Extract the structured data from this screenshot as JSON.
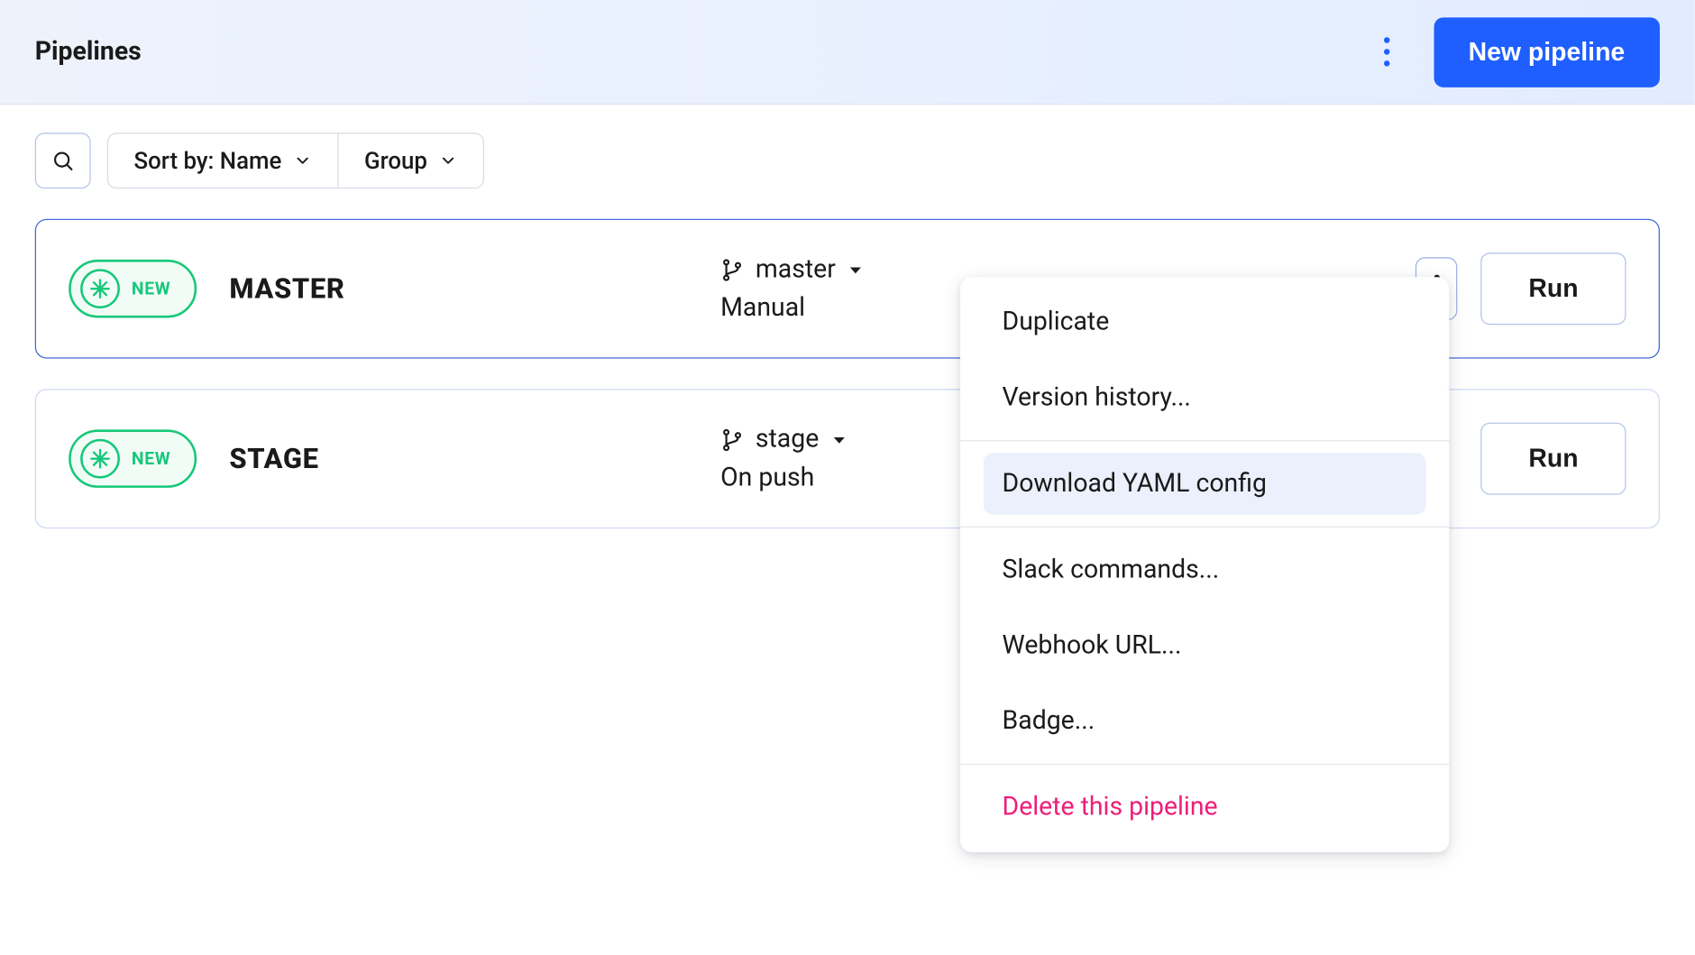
{
  "header": {
    "title": "Pipelines",
    "new_pipeline_label": "New pipeline"
  },
  "toolbar": {
    "sort_label": "Sort by: Name",
    "group_label": "Group"
  },
  "pipelines": [
    {
      "badge": "NEW",
      "name": "MASTER",
      "branch": "master",
      "trigger": "Manual",
      "run_label": "Run",
      "selected": true,
      "menu_open": true
    },
    {
      "badge": "NEW",
      "name": "STAGE",
      "branch": "stage",
      "trigger": "On push",
      "run_label": "Run",
      "selected": false,
      "menu_open": false
    }
  ],
  "menu": {
    "items": [
      {
        "label": "Duplicate"
      },
      {
        "label": "Version history...",
        "sep_after": true
      },
      {
        "label": "Download YAML config",
        "hover": true,
        "sep_after": true
      },
      {
        "label": "Slack commands..."
      },
      {
        "label": "Webhook URL..."
      },
      {
        "label": "Badge...",
        "sep_after": true
      },
      {
        "label": "Delete this pipeline",
        "danger": true
      }
    ]
  }
}
